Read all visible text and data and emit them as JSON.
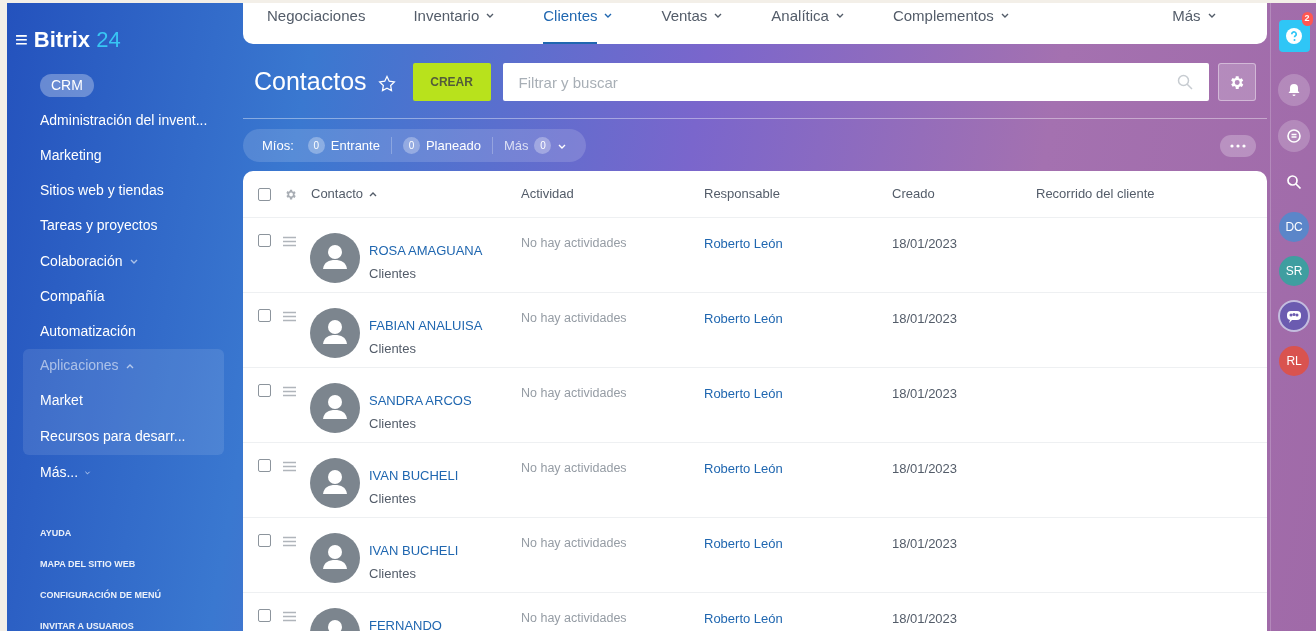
{
  "logo": {
    "icon": "≡",
    "name": "Bitrix",
    "suffix": "24"
  },
  "sidebar": {
    "items": [
      {
        "label": "CRM",
        "kind": "pill",
        "selected": true
      },
      {
        "label": "Administración del invent...",
        "kind": "link",
        "selected": false
      },
      {
        "label": "Marketing",
        "kind": "link",
        "selected": false
      },
      {
        "label": "Sitios web y tiendas",
        "kind": "link",
        "selected": false
      },
      {
        "label": "Tareas y proyectos",
        "kind": "link",
        "selected": false
      },
      {
        "label": "Colaboración",
        "kind": "group",
        "selected": false,
        "expanded": false
      },
      {
        "label": "Compañía",
        "kind": "link",
        "selected": false
      },
      {
        "label": "Automatización",
        "kind": "link",
        "selected": false
      },
      {
        "label": "Aplicaciones",
        "kind": "group",
        "selected": false,
        "expanded": true,
        "children": [
          {
            "label": "Market",
            "kind": "link",
            "selected": false
          },
          {
            "label": "Recursos para desarr...",
            "kind": "link",
            "selected": false
          }
        ]
      },
      {
        "label": "Más...",
        "kind": "more",
        "selected": false
      }
    ],
    "footer_links": [
      "AYUDA",
      "MAPA DEL SITIO WEB",
      "CONFIGURACIÓN DE MENÚ",
      "INVITAR A USUARIOS"
    ]
  },
  "top_nav": [
    {
      "label": "Negociaciones",
      "dropdown": false,
      "selected": false
    },
    {
      "label": "Inventario",
      "dropdown": true,
      "selected": false
    },
    {
      "label": "Clientes",
      "dropdown": true,
      "selected": true
    },
    {
      "label": "Ventas",
      "dropdown": true,
      "selected": false
    },
    {
      "label": "Analítica",
      "dropdown": true,
      "selected": false
    },
    {
      "label": "Complementos",
      "dropdown": true,
      "selected": false
    },
    {
      "label": "Más",
      "dropdown": true,
      "selected": false
    }
  ],
  "page_title": "Contactos",
  "create_button": "CREAR",
  "search": {
    "placeholder": "Filtrar y buscar"
  },
  "counters": {
    "label": "Míos:",
    "items": [
      {
        "count": "0",
        "label": "Entrante",
        "dropdown": false
      },
      {
        "count": "0",
        "label": "Planeado",
        "dropdown": false
      },
      {
        "count": "0",
        "label": "Más",
        "dropdown": true
      }
    ]
  },
  "table": {
    "select_all_checked": false,
    "columns": [
      "Contacto",
      "Actividad",
      "Responsable",
      "Creado",
      "Recorrido del cliente"
    ],
    "rows": [
      {
        "checked": false,
        "name": "ROSA AMAGUANA",
        "type": "Clientes",
        "activity": "No hay actividades",
        "responsible": "Roberto León",
        "created": "18/01/2023"
      },
      {
        "checked": false,
        "name": "FABIAN ANALUISA",
        "type": "Clientes",
        "activity": "No hay actividades",
        "responsible": "Roberto León",
        "created": "18/01/2023"
      },
      {
        "checked": false,
        "name": "SANDRA ARCOS",
        "type": "Clientes",
        "activity": "No hay actividades",
        "responsible": "Roberto León",
        "created": "18/01/2023"
      },
      {
        "checked": false,
        "name": "IVAN BUCHELI",
        "type": "Clientes",
        "activity": "No hay actividades",
        "responsible": "Roberto León",
        "created": "18/01/2023"
      },
      {
        "checked": false,
        "name": "IVAN BUCHELI",
        "type": "Clientes",
        "activity": "No hay actividades",
        "responsible": "Roberto León",
        "created": "18/01/2023"
      },
      {
        "checked": false,
        "name": "FERNANDO",
        "activity": "No hay actividades",
        "responsible": "Roberto León",
        "created": "18/01/2023"
      }
    ]
  },
  "right_rail": {
    "help_badge": "2",
    "items": [
      {
        "kind": "bell"
      },
      {
        "kind": "chat"
      },
      {
        "kind": "search"
      },
      {
        "kind": "avatar",
        "initials": "DC",
        "color": "#5b86c9"
      },
      {
        "kind": "avatar",
        "initials": "SR",
        "color": "#3f9ea0"
      },
      {
        "kind": "group"
      },
      {
        "kind": "avatar",
        "initials": "RL",
        "color": "#d9534f"
      }
    ]
  }
}
